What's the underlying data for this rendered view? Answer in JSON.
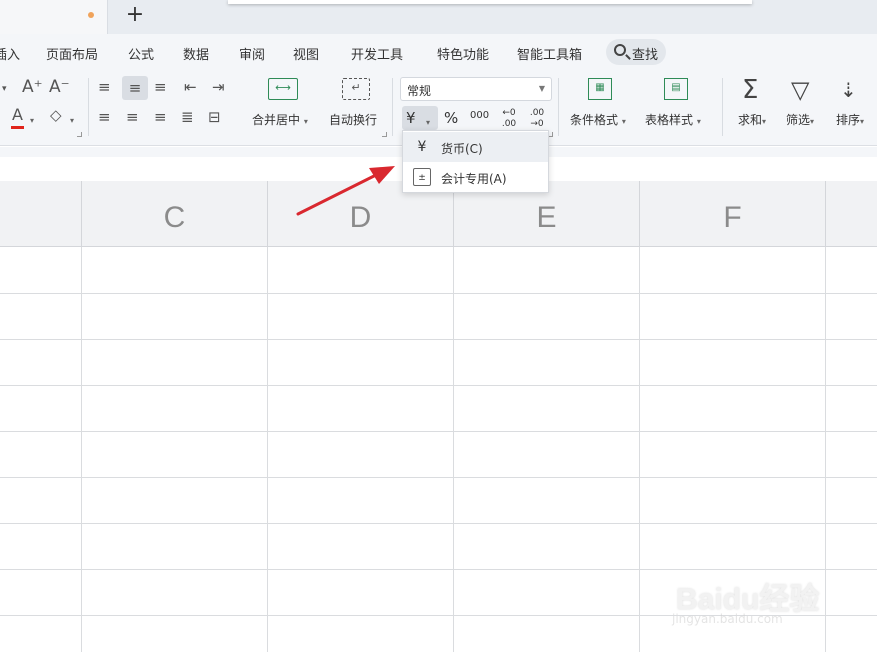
{
  "tabs": {
    "new_tab_label": "+"
  },
  "menu": [
    "插入",
    "页面布局",
    "公式",
    "数据",
    "审阅",
    "视图",
    "开发工具",
    "特色功能",
    "智能工具箱"
  ],
  "search": {
    "label": "查找"
  },
  "font_tools": {
    "grow": "A⁺",
    "shrink": "A⁻",
    "font_color": "A"
  },
  "merge": {
    "label": "合并居中"
  },
  "wrap": {
    "label": "自动换行"
  },
  "number_format": {
    "current": "常规",
    "currency_symbol": "¥",
    "percent": "%",
    "thousands": "000",
    "inc_decimal": "←0 .00",
    "dec_decimal": ".00 →0"
  },
  "currency_menu": {
    "items": [
      {
        "icon": "¥",
        "label": "货币(C)",
        "highlighted": true
      },
      {
        "icon": "±",
        "label": "会计专用(A)",
        "highlighted": false
      }
    ]
  },
  "styles": {
    "conditional": "条件格式",
    "table_style": "表格样式"
  },
  "tools": {
    "sum": "求和",
    "filter": "筛选",
    "sort": "排序"
  },
  "columns": [
    "C",
    "D",
    "E",
    "F"
  ],
  "watermark": {
    "main": "Baidu经验",
    "sub": "jingyan.baidu.com"
  },
  "colors": {
    "accent_arrow": "#d9282f",
    "font_color_bar": "#e0241b"
  }
}
